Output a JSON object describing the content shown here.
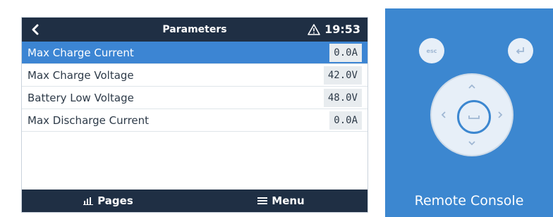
{
  "screen": {
    "title": "Parameters",
    "time": "19:53",
    "icons": {
      "back": "chevron-left-icon",
      "alert": "warning-triangle-icon"
    },
    "rows": [
      {
        "label": "Max Charge Current",
        "value": "0.0A"
      },
      {
        "label": "Max Charge Voltage",
        "value": "42.0V"
      },
      {
        "label": "Battery Low Voltage",
        "value": "48.0V"
      },
      {
        "label": "Max Discharge Current",
        "value": "0.0A"
      }
    ],
    "bottom": {
      "pages_label": "Pages",
      "menu_label": "Menu"
    }
  },
  "remote": {
    "esc_label": "esc",
    "title": "Remote Console",
    "colors": {
      "panel": "#3c87d0",
      "button": "#e7eff8"
    }
  },
  "colors": {
    "topbar": "#1f2f44",
    "selected_row": "#3c85d3"
  }
}
